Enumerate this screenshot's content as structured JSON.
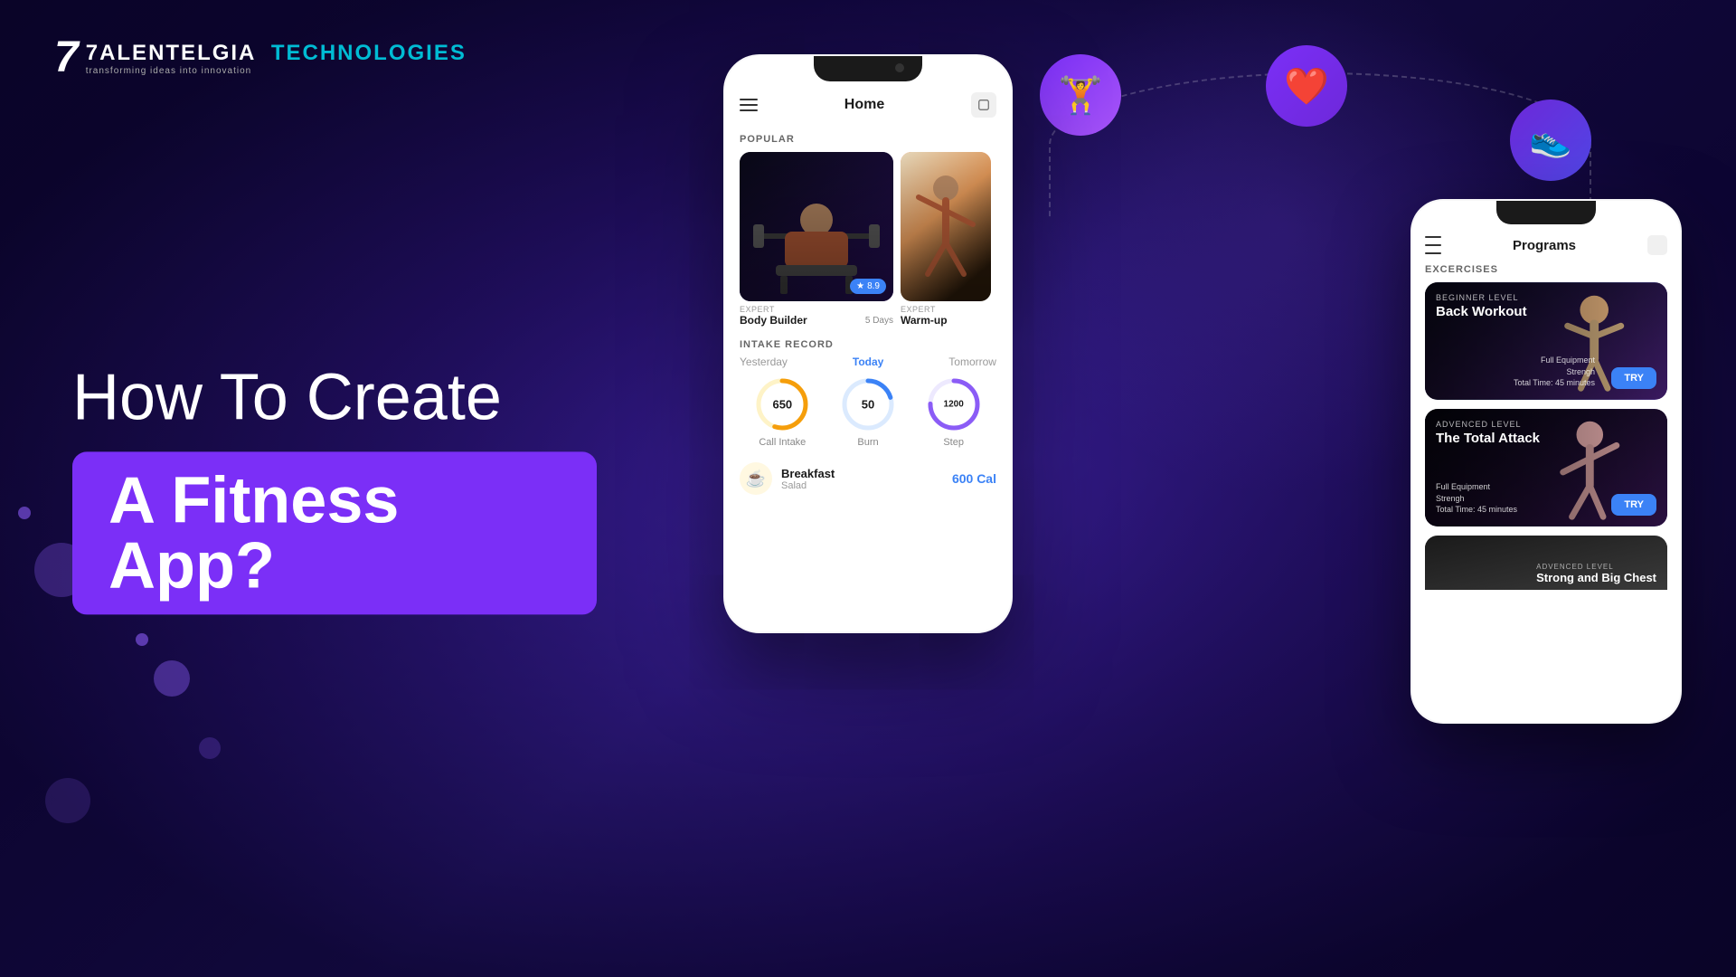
{
  "brand": {
    "logo_number": "7",
    "logo_name_part1": "ALENTELGIA",
    "logo_cyan": "TECHNOLOGIES",
    "logo_tagline": "transforming ideas into innovation"
  },
  "headline": {
    "line1": "How To Create",
    "line2": "A Fitness App?"
  },
  "phone_main": {
    "title": "Home",
    "popular_label": "POPULAR",
    "cards": [
      {
        "type": "EXPERT",
        "name": "Body Builder",
        "days": "5 Days",
        "rating": "8.9",
        "size": "large"
      },
      {
        "type": "EXPERT",
        "name": "Warm-up",
        "days": "",
        "rating": "",
        "size": "small"
      }
    ],
    "intake_label": "INTAKE RECORD",
    "intake_tabs": [
      "Yesterday",
      "Today",
      "Tomorrow"
    ],
    "active_tab": "Today",
    "circles": [
      {
        "value": "650",
        "label": "Call Intake",
        "color": "#f59e0b",
        "bg": "#fef3c7",
        "pct": 55
      },
      {
        "value": "50",
        "label": "Burn",
        "color": "#3b82f6",
        "bg": "#dbeafe",
        "pct": 20
      },
      {
        "value": "1200",
        "label": "Step",
        "color": "#8b5cf6",
        "bg": "#ede9fe",
        "pct": 75
      }
    ],
    "breakfast": {
      "name": "Breakfast",
      "sub": "Salad",
      "cal": "600 Cal"
    }
  },
  "phone_second": {
    "title": "Programs",
    "exercises_label": "EXCERCISES",
    "exercises": [
      {
        "level": "BEGINNER LEVEL",
        "name": "Back Workout",
        "detail1": "Full Equipment",
        "detail2": "Strengh",
        "time": "Total Time: 45 minutes",
        "try_label": "TRY"
      },
      {
        "level": "ADVENCED LEVEL",
        "name": "The Total Attack",
        "detail1": "Full Equipment",
        "detail2": "Strengh",
        "time": "Total Time: 45 minutes",
        "try_label": "TRY"
      },
      {
        "level": "ADVENCED LEVEL",
        "name": "Strong and Big Chest",
        "detail1": "",
        "detail2": "",
        "time": "",
        "try_label": ""
      }
    ]
  },
  "floating_icons": {
    "dumbbell": "🏋️",
    "heart": "❤️",
    "shoe": "👟"
  }
}
